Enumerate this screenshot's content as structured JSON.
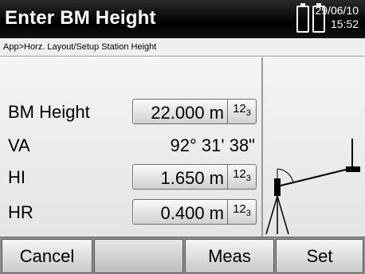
{
  "header": {
    "title": "Enter BM Height",
    "date": "29/06/10",
    "time": "15:52",
    "battery_icons": [
      "battery-icon",
      "battery-icon"
    ]
  },
  "breadcrumb": "App>Horz. Layout/Setup Station Height",
  "fields": [
    {
      "label": "BM Height",
      "value": "22.000 m",
      "editable": true
    },
    {
      "label": "VA",
      "value": "92° 31' 38\"",
      "editable": false
    },
    {
      "label": "HI",
      "value": "1.650 m",
      "editable": true
    },
    {
      "label": "HR",
      "value": "0.400 m",
      "editable": true
    }
  ],
  "keypad_icon": {
    "main": "12",
    "sub": "3"
  },
  "softkeys": [
    "Cancel",
    "",
    "Meas",
    "Set"
  ],
  "diagram_icon": "tripod-target-diagram"
}
